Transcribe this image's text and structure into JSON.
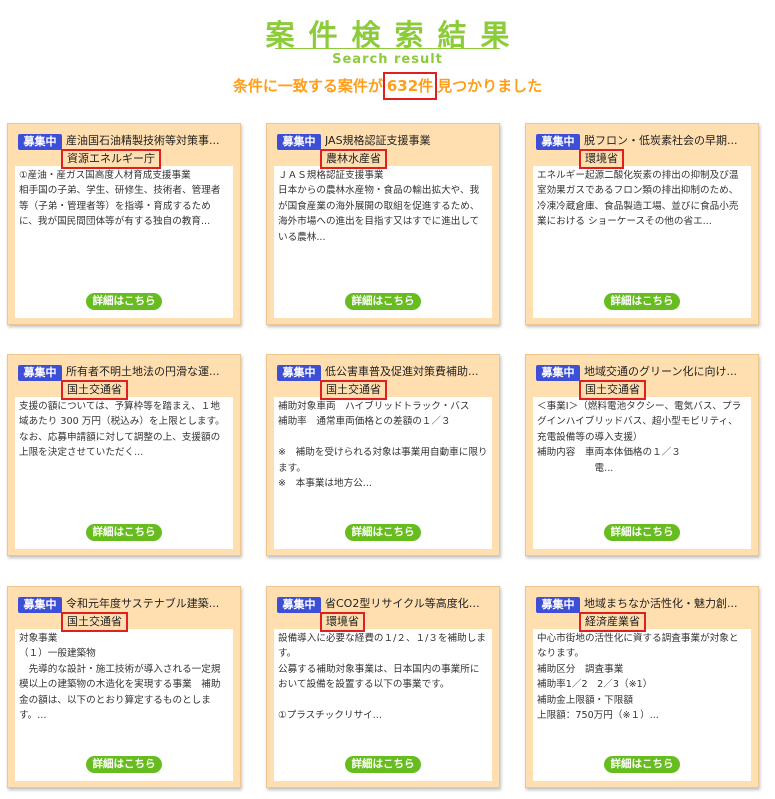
{
  "header": {
    "title": "案件検索結果",
    "subtitle": "Search result",
    "result_prefix": "条件に一致する案件が",
    "result_count": "632件",
    "result_suffix": "見つかりました"
  },
  "colors": {
    "accent_green": "#8ccc3a",
    "count_orange": "#ff9e1b",
    "badge_blue": "#3d4fd6",
    "card_bg": "#ffdeb0",
    "button_green": "#67bd1f",
    "highlight_red": "#e02020"
  },
  "cards": [
    {
      "badge": "募集中",
      "title": "産油国石油精製技術等対策事...",
      "ministry": "資源エネルギー庁",
      "description": "①産油・産ガス国高度人材育成支援事業\n相手国の子弟、学生、研修生、技術者、管理者等（子弟・管理者等）を指導・育成するために、我が国民間団体等が有する独自の教育...",
      "button": "詳細はこちら"
    },
    {
      "badge": "募集中",
      "title": "JAS規格認証支援事業",
      "ministry": "農林水産省",
      "description": "ＪＡＳ規格認証支援事業\n日本からの農林水産物・食品の輸出拡大や、我が国食産業の海外展開の取組を促進するため、海外市場への進出を目指す又はすでに進出している農林...",
      "button": "詳細はこちら"
    },
    {
      "badge": "募集中",
      "title": "脱フロン・低炭素社会の早期...",
      "ministry": "環境省",
      "description": "エネルギー起源二酸化炭素の排出の抑制及び温室効果ガスであるフロン類の排出抑制のため、冷凍冷蔵倉庫、食品製造工場、並びに食品小売業における ショーケースその他の省エ...",
      "button": "詳細はこちら"
    },
    {
      "badge": "募集中",
      "title": "所有者不明土地法の円滑な運...",
      "ministry": "国土交通省",
      "description": "支援の額については、予算枠等を踏まえ、１地域あたり 300 万円（税込み）を上限とします。 なお、応募申請額に対して調整の上、支援額の上限を決定させていただく...",
      "button": "詳細はこちら"
    },
    {
      "badge": "募集中",
      "title": "低公害車普及促進対策費補助...",
      "ministry": "国土交通省",
      "description": "補助対象車両　ハイブリッドトラック・バス\n補助率　通常車両価格との差額の１／３\n\n※　補助を受けられる対象は事業用自動車に限ります。\n※　本事業は地方公...",
      "button": "詳細はこちら"
    },
    {
      "badge": "募集中",
      "title": "地域交通のグリーン化に向け...",
      "ministry": "国土交通省",
      "description": "＜事業Ⅰ＞（燃料電池タクシー、電気バス、プラグインハイブリッドバス、超小型モビリティ、充電設備等の導入支援）\n補助内容　車両本体価格の１／３\n　　　　　　電...",
      "button": "詳細はこちら"
    },
    {
      "badge": "募集中",
      "title": "令和元年度サステナブル建築...",
      "ministry": "国土交通省",
      "description": "対象事業\n（１）一般建築物\n　先導的な設計・施工技術が導入される一定規模以上の建築物の木造化を実現する事業　補助金の額は、以下のとおり算定するものとします。...",
      "button": "詳細はこちら"
    },
    {
      "badge": "募集中",
      "title": "省CO2型リサイクル等高度化設...",
      "ministry": "環境省",
      "description": "設備導入に必要な経費の１/２、１/３を補助します。\n公募する補助対象事業は、日本国内の事業所において設備を設置する以下の事業です。\n\n①プラスチックリサイ...",
      "button": "詳細はこちら"
    },
    {
      "badge": "募集中",
      "title": "地域まちなか活性化・魅力創...",
      "ministry": "経済産業省",
      "description": "中心市街地の活性化に資する調査事業が対象となります。\n補助区分　調査事業\n補助率1／2　2／3（※1）\n補助金上限額・下限額\n上限額：750万円（※１）...",
      "button": "詳細はこちら"
    }
  ]
}
